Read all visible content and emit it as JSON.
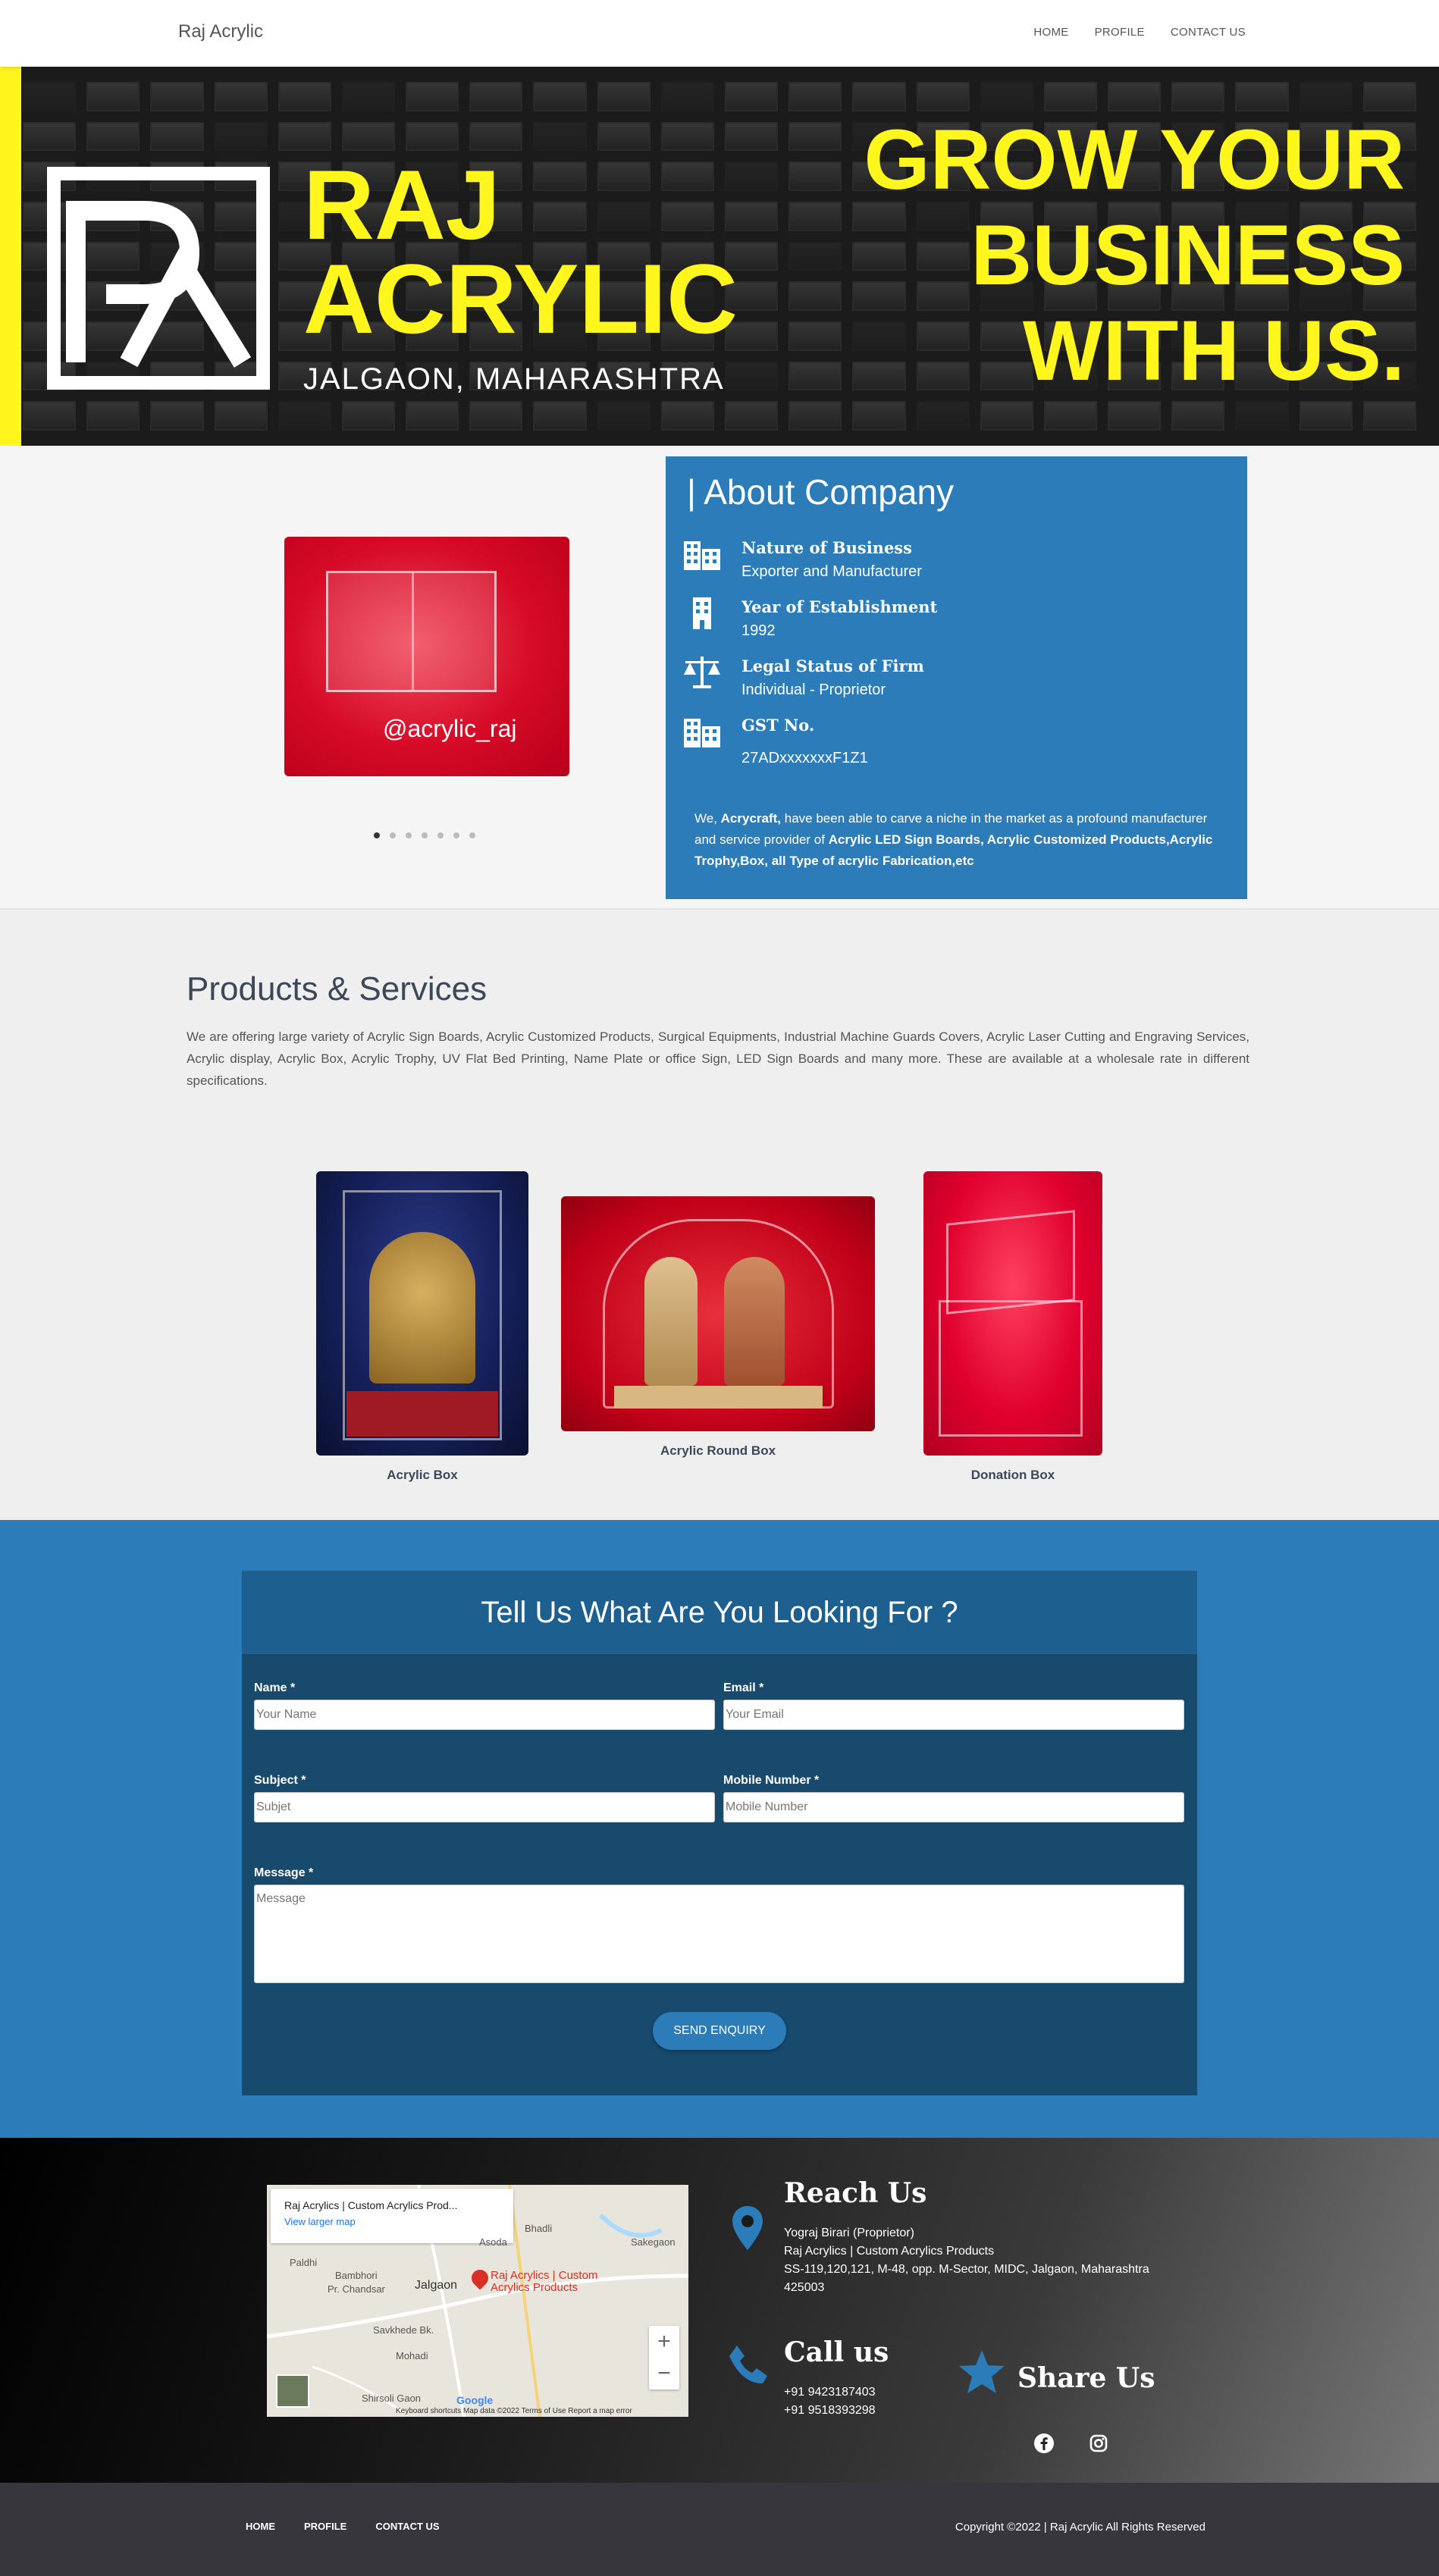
{
  "navbar": {
    "brand": "Raj Acrylic",
    "links": [
      "HOME",
      "PROFILE",
      "CONTACT US"
    ]
  },
  "hero": {
    "logo_line1": "RAJ",
    "logo_line2": "ACRYLIC",
    "location": "JALGAON, MAHARASHTRA",
    "tagline_line1": "GROW YOUR",
    "tagline_line2": "BUSINESS",
    "tagline_line3": "WITH US.",
    "accent_color": "#fff61e"
  },
  "carousel": {
    "caption": "@acrylic_raj",
    "slide_count": 7,
    "active_index": 0
  },
  "about": {
    "title": "| About Company",
    "facts": [
      {
        "label": "Nature of Business",
        "value": "Exporter and Manufacturer",
        "icon": "building-icon"
      },
      {
        "label": "Year of Establishment",
        "value": "1992",
        "icon": "office-building-icon"
      },
      {
        "label": "Legal Status of Firm",
        "value": "Individual - Proprietor",
        "icon": "scale-icon"
      },
      {
        "label": "GST No.",
        "value": "27ADxxxxxxxF1Z1",
        "icon": "building-icon"
      }
    ],
    "desc_prefix": "We, ",
    "desc_company": "Acrycraft,",
    "desc_middle": " have been able to carve a niche in the market as a profound manufacturer and service provider of ",
    "desc_products": "Acrylic LED Sign Boards, Acrylic Customized Products,Acrylic Trophy,Box, all Type of acrylic Fabrication,etc",
    "card_color": "#2b7cb8"
  },
  "products": {
    "title": "Products & Services",
    "description": "We are offering large variety of Acrylic Sign Boards, Acrylic Customized Products, Surgical Equipments, Industrial Machine Guards Covers, Acrylic Laser Cutting and Engraving Services, Acrylic display, Acrylic Box, Acrylic Trophy, UV Flat Bed Printing, Name Plate or office Sign, LED Sign Boards and many more. These are available at a wholesale rate in different specifications.",
    "items": [
      {
        "name": "Acrylic Box"
      },
      {
        "name": "Acrylic Round Box"
      },
      {
        "name": "Donation Box"
      }
    ]
  },
  "enquiry": {
    "title": "Tell Us What Are You Looking For ?",
    "name_label": "Name *",
    "name_placeholder": "Your Name",
    "email_label": "Email *",
    "email_placeholder": "Your Email",
    "subject_label": "Subject *",
    "subject_placeholder": "Subjet",
    "mobile_label": "Mobile Number *",
    "mobile_placeholder": "Mobile Number",
    "message_label": "Message *",
    "message_placeholder": "Message",
    "submit": "SEND ENQUIRY"
  },
  "map": {
    "place": "Raj Acrylics | Custom Acrylics Prod...",
    "larger_link": "View larger map",
    "pin_label_1": "Raj Acrylics | Custom",
    "pin_label_2": "Acrylics Products",
    "labels": [
      "Bhadli",
      "Asoda",
      "Sakegaon",
      "Paldhi",
      "Bambhori",
      "Pr. Chandsar",
      "Jalgaon",
      "Savkhede Bk.",
      "Mohadi",
      "Shirsoli Gaon"
    ],
    "footer": "Keyboard shortcuts   Map data ©2022   Terms of Use   Report a map error",
    "google": "Google"
  },
  "contact": {
    "reach_title": "Reach Us",
    "reach_lines": [
      "Yograj Birari (Proprietor)",
      "Raj Acrylics | Custom Acrylics Products",
      "SS-119,120,121, M-48, opp. M-Sector, MIDC, Jalgaon, Maharashtra",
      "425003"
    ],
    "call_title": "Call us",
    "phones": [
      "+91 9423187403",
      "+91 9518393298"
    ],
    "share_title": "Share Us"
  },
  "footer": {
    "links": [
      "HOME",
      "PROFILE",
      "CONTACT US"
    ],
    "copyright": "Copyright ©2022 | Raj Acrylic All Rights Reserved"
  }
}
